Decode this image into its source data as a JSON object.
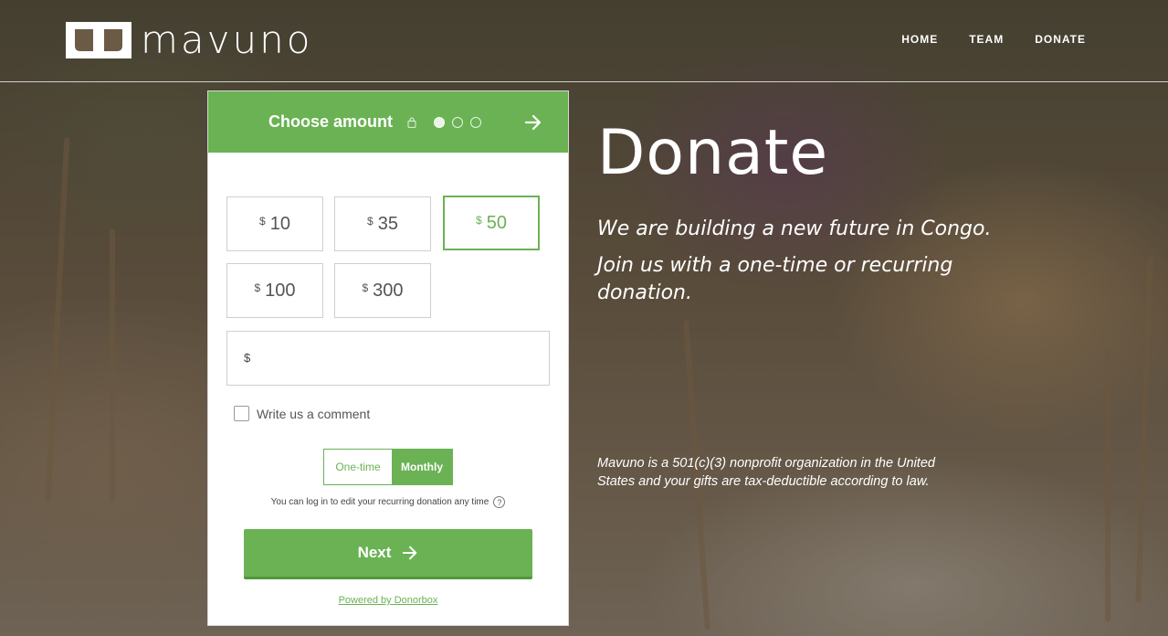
{
  "brand": {
    "name": "mavuno",
    "accent": "#6ab254"
  },
  "nav": {
    "items": [
      "HOME",
      "TEAM",
      "DONATE"
    ]
  },
  "form": {
    "step_title": "Choose amount",
    "step_icons": [
      "lock-icon",
      "step-dot-1",
      "step-dot-2",
      "step-dot-3",
      "arrow-right-icon"
    ],
    "currency_symbol": "$",
    "amounts": [
      "10",
      "35",
      "50",
      "100",
      "300"
    ],
    "selected_amount": "50",
    "custom_amount": {
      "value": "",
      "placeholder": ""
    },
    "comment_label": "Write us a comment",
    "comment_checked": false,
    "frequency": {
      "one_time": "One-time",
      "monthly": "Monthly",
      "selected": "Monthly"
    },
    "recurring_note": "You can log in to edit your recurring donation any time",
    "help_icon": "?",
    "next_label": "Next",
    "powered_by": "Powered by Donorbox"
  },
  "hero": {
    "title": "Donate",
    "line1": "We are building a new future in Congo.",
    "line2": "Join us with a one-time or recurring",
    "line3": "donation.",
    "legal_line1": "Mavuno is a 501(c)(3) nonprofit organization in the United",
    "legal_line2": "States and your gifts are tax-deductible according to law."
  }
}
